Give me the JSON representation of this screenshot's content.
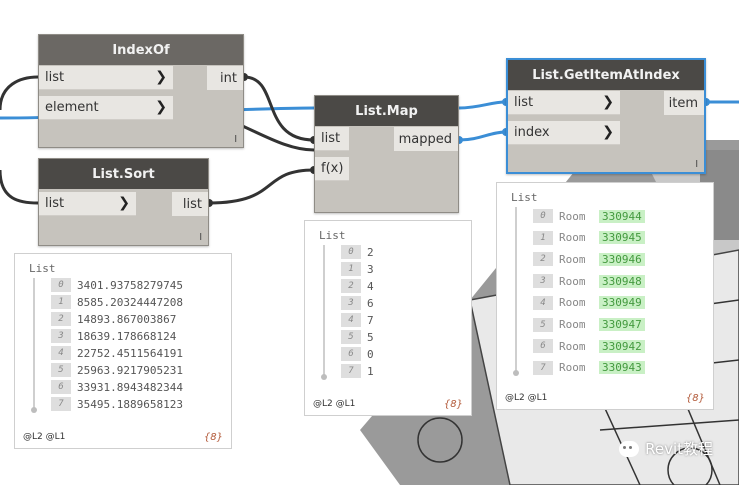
{
  "nodes": {
    "indexof": {
      "title": "IndexOf",
      "inputs": [
        "list",
        "element"
      ],
      "output": "int",
      "lacing": "l"
    },
    "list_sort": {
      "title": "List.Sort",
      "input": "list",
      "output": "list",
      "lacing": "l"
    },
    "list_map": {
      "title": "List.Map",
      "inputs": [
        "list",
        "f(x)"
      ],
      "output": "mapped"
    },
    "get_item": {
      "title": "List.GetItemAtIndex",
      "inputs": [
        "list",
        "index"
      ],
      "output": "item",
      "lacing": "l"
    }
  },
  "previews": {
    "sort": {
      "header": "List",
      "indices": [
        "0",
        "1",
        "2",
        "3",
        "4",
        "5",
        "6",
        "7"
      ],
      "values": [
        "3401.93758279745",
        "8585.20324447208",
        "14893.867003867",
        "18639.178668124",
        "22752.4511564191",
        "25963.9217905231",
        "33931.8943482344",
        "35495.1889658123"
      ],
      "levels": "@L2 @L1",
      "count": "{8}"
    },
    "map": {
      "header": "List",
      "indices": [
        "0",
        "1",
        "2",
        "3",
        "4",
        "5",
        "6",
        "7"
      ],
      "values": [
        "2",
        "3",
        "4",
        "6",
        "7",
        "5",
        "0",
        "1"
      ],
      "levels": "@L2 @L1",
      "count": "{8}"
    },
    "getitem": {
      "header": "List",
      "indices": [
        "0",
        "1",
        "2",
        "3",
        "4",
        "5",
        "6",
        "7"
      ],
      "prefix": "Room",
      "values": [
        "330944",
        "330945",
        "330946",
        "330948",
        "330949",
        "330947",
        "330942",
        "330943"
      ],
      "levels": "@L2 @L1",
      "count": "{8}"
    }
  },
  "watermark": {
    "text": "Revit教程"
  },
  "colors": {
    "selected_wire": "#3b8ed6",
    "wire": "#333333",
    "title_bar": "#4b4946",
    "node_body": "#c6c3bd",
    "highlight_value": "#c9f0c5"
  }
}
